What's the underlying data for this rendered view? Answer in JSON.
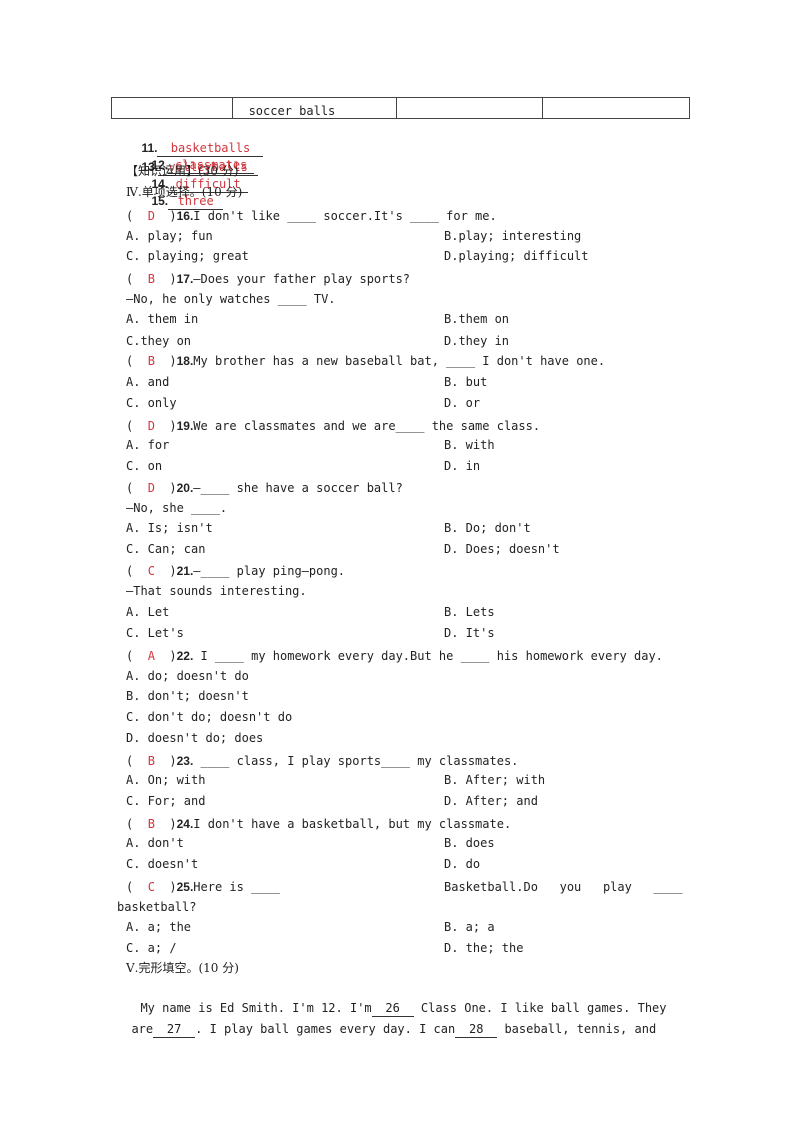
{
  "table": {
    "cells": [
      "",
      "soccer balls",
      "",
      ""
    ]
  },
  "answers_fill": [
    {
      "num": "11.",
      "answer": "basketballs"
    },
    {
      "num": "12.",
      "answer": "classmates"
    },
    {
      "num": "13.",
      "answer": "volleyballs"
    },
    {
      "num": "14.",
      "answer": "difficult"
    },
    {
      "num": "15.",
      "answer": "three"
    }
  ],
  "section_knowledge": "【知识运用】(30 分)",
  "section_iv": "Ⅳ.单项选择。(10 分)",
  "questions": [
    {
      "answer": "D",
      "num": "16.",
      "stem": "I don't like ____ soccer.It's ____ for me.",
      "options": [
        "A. play; fun",
        "B.play; interesting",
        "C. playing; great",
        "D.playing; difficult"
      ]
    },
    {
      "answer": "B",
      "num": "17.",
      "stem": "—Does your father play sports?",
      "stem2": "—No, he only watches ____ TV.",
      "options": [
        "A. them in",
        "B.them on",
        "C.they on",
        "D.they in"
      ]
    },
    {
      "answer": "B",
      "num": "18.",
      "stem": "My brother has a new baseball bat, ____ I don't have one.",
      "options": [
        "A. and",
        "B. but",
        "C. only",
        "D. or"
      ]
    },
    {
      "answer": "D",
      "num": "19.",
      "stem": "We are classmates and we are____ the same class.",
      "options": [
        "A. for",
        "B. with",
        "C. on",
        "D. in"
      ]
    },
    {
      "answer": "D",
      "num": "20.",
      "stem": "—____ she have a soccer ball?",
      "stem2": "—No, she ____.",
      "options": [
        "A. Is; isn't",
        "B. Do; don't",
        "C. Can; can",
        "D. Does; doesn't"
      ]
    },
    {
      "answer": "C",
      "num": "21.",
      "stem": "—____ play ping—pong.",
      "stem2": "—That sounds interesting.",
      "options": [
        "A. Let",
        "B. Lets",
        "C. Let's",
        "D. It's"
      ]
    },
    {
      "answer": "A",
      "num": "22.",
      "stem": " I ____ my homework every day.But he ____ his homework every day.",
      "options": [
        "A. do; doesn't do",
        "B. don't; doesn't",
        "C. don't do; doesn't do",
        "D. doesn't do; does"
      ]
    },
    {
      "answer": "B",
      "num": "23.",
      "stem": " ____ class, I play sports____ my classmates.",
      "options": [
        "A. On; with",
        "B. After; with",
        "C. For; and",
        "D. After; and"
      ]
    },
    {
      "answer": "B",
      "num": "24.",
      "stem": "I don't have a basketball, but my classmate.",
      "options": [
        "A. don't",
        "B. does",
        "C. doesn't",
        "D. do"
      ]
    },
    {
      "answer": "C",
      "num": "25.",
      "stem": "Here is ____",
      "stem_right": "Basketball.Do   you   play   ____",
      "stem2": "basketball?",
      "options": [
        "A. a; the",
        "B. a; a",
        "C. a; /",
        "D. the; the"
      ]
    }
  ],
  "section_v": "Ⅴ.完形填空。(10 分)",
  "cloze": {
    "line1_a": "My name is Ed Smith. I'm 12. I'm",
    "blank26": "26",
    "line1_b": " Class One. I like ball games. They",
    "line2_a": "are",
    "blank27": "27",
    "line2_b": ". I play ball games every day. I can",
    "blank28": "28",
    "line2_c": " baseball, tennis, and"
  },
  "colors": {
    "answer_red": "#d0373d",
    "text": "#222222"
  }
}
